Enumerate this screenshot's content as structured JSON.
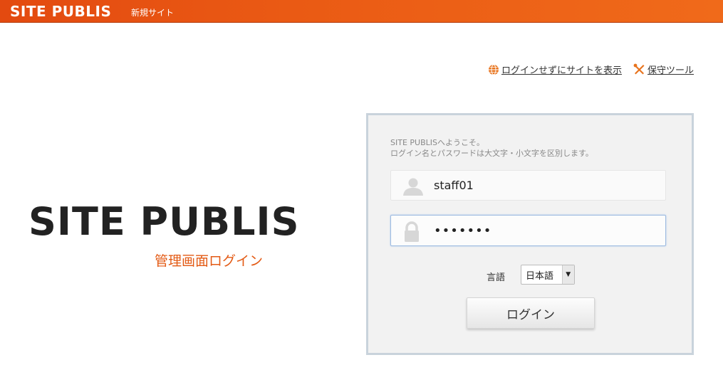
{
  "header": {
    "brand": "SITE PUBLIS",
    "site_name": "新規サイト"
  },
  "top_links": {
    "view_site": {
      "label": "ログインせずにサイトを表示",
      "icon": "globe-icon"
    },
    "maintenance": {
      "label": "保守ツール",
      "icon": "tools-icon"
    }
  },
  "hero": {
    "title": "SITE PUBLIS",
    "subtitle": "管理画面ログイン"
  },
  "login": {
    "welcome_line1": "SITE PUBLISへようこそ。",
    "welcome_line2": "ログイン名とパスワードは大文字・小文字を区別します。",
    "username_value": "staff01",
    "username_icon": "user-icon",
    "password_value": "•••••••",
    "password_icon": "lock-icon",
    "language_label": "言語",
    "language_value": "日本語",
    "submit_label": "ログイン"
  },
  "colors": {
    "accent": "#e85a14",
    "panel_bg": "#f2f2f2",
    "panel_border": "#c9d3dc"
  }
}
